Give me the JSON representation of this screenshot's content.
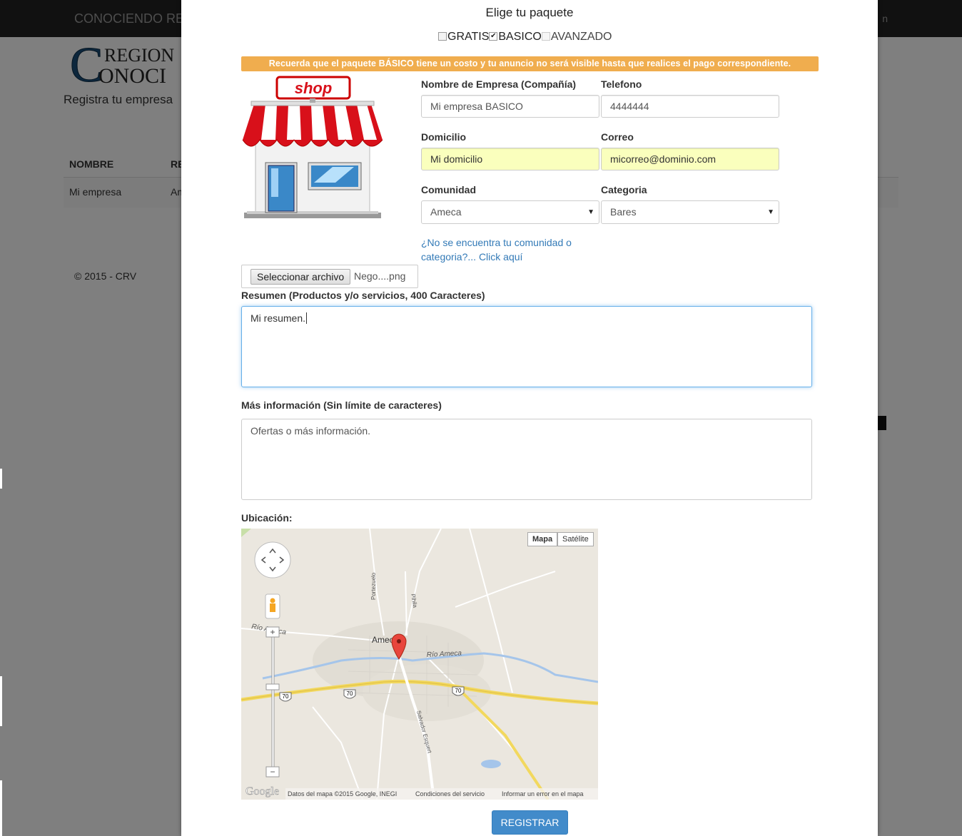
{
  "background": {
    "brand": "CONOCIENDO RE",
    "nav_right": "n",
    "subtitle": "Registra tu empresa",
    "table": {
      "headers": [
        "NOMBRE",
        "RE"
      ],
      "row": [
        "Mi empresa",
        "Am"
      ]
    },
    "footer": "© 2015 - CRV"
  },
  "modal": {
    "title": "Elige tu paquete",
    "packages": [
      {
        "label": "GRATIS",
        "checked": false,
        "enabled": true
      },
      {
        "label": "BASICO",
        "checked": true,
        "enabled": true
      },
      {
        "label": "AVANZADO",
        "checked": false,
        "enabled": false
      }
    ],
    "alert": "Recuerda que el paquete BÁSICO tiene un costo y tu anuncio no será visible hasta que realices el pago correspondiente.",
    "shop_sign": "shop",
    "fields": {
      "company_label": "Nombre de Empresa (Compañía)",
      "company_value": "Mi empresa BASICO",
      "phone_label": "Telefono",
      "phone_value": "4444444",
      "address_label": "Domicilio",
      "address_value": "Mi domicilio",
      "email_label": "Correo",
      "email_value": "micorreo@dominio.com",
      "community_label": "Comunidad",
      "community_value": "Ameca",
      "category_label": "Categoria",
      "category_value": "Bares"
    },
    "missing_link_line1": "¿No se encuentra tu comunidad o",
    "missing_link_line2": "categoria?... Click aquí",
    "file": {
      "button": "Seleccionar archivo",
      "filename": "Nego....png"
    },
    "summary_label": "Resumen (Productos y/o servicios, 400 Caracteres)",
    "summary_value": "Mi resumen.",
    "more_label": "Más información (Sin límite de caracteres)",
    "more_placeholder": "Ofertas o más información.",
    "location_label": "Ubicación:",
    "map": {
      "type_map": "Mapa",
      "type_satellite": "Satélite",
      "city": "Ameca",
      "river1": "Río Ameca",
      "river2": "Río Ameca",
      "street1": "Portezuelo",
      "street2": "Pihila",
      "street3": "Salvador Esquert",
      "route": "70",
      "copyright": "Datos del mapa ©2015 Google, INEGI",
      "terms": "Condiciones del servicio",
      "report": "Informar un error en el mapa",
      "google": "Google"
    },
    "register_button": "REGISTRAR"
  },
  "colors": {
    "alert": "#f0ad4e",
    "primary": "#428bca",
    "autofill": "#faffbd",
    "link": "#337ab7"
  }
}
